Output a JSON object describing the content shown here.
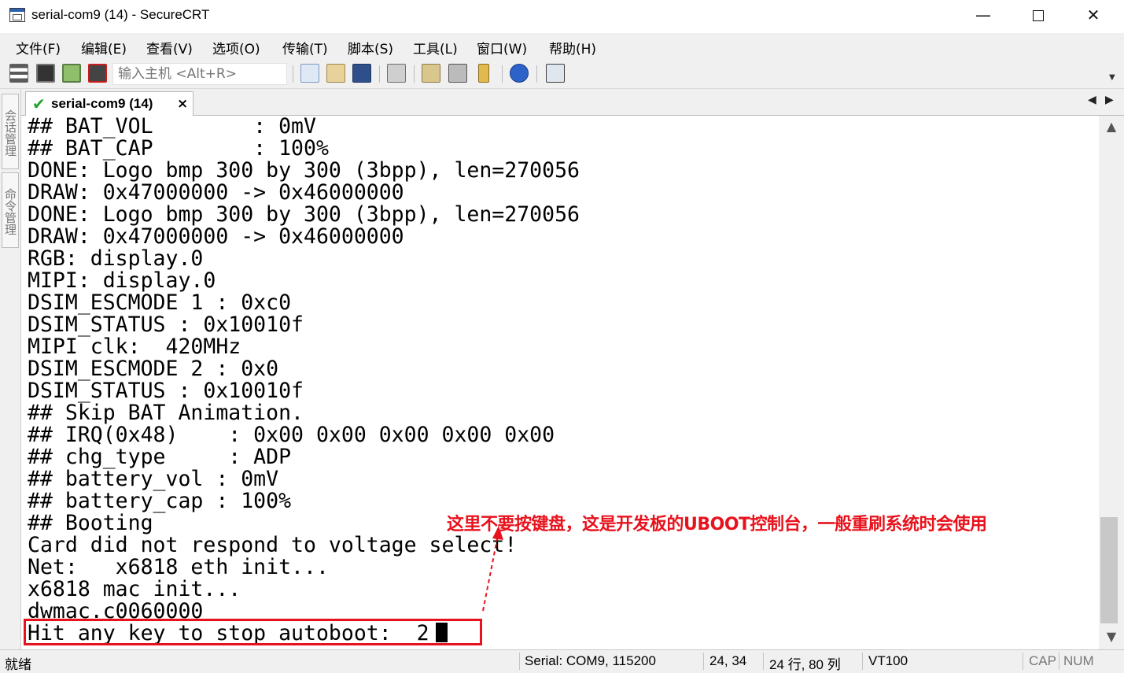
{
  "window": {
    "title": "serial-com9 (14) - SecureCRT",
    "minimize_label": "—",
    "close_label": "✕"
  },
  "menu": {
    "items": [
      "文件(F)",
      "编辑(E)",
      "查看(V)",
      "选项(O)",
      "传输(T)",
      "脚本(S)",
      "工具(L)",
      "窗口(W)",
      "帮助(H)"
    ]
  },
  "toolbar": {
    "host_placeholder": "输入主机 <Alt+R>",
    "icons": [
      "connect-icon",
      "quick-connect-icon",
      "reconnect-icon",
      "disconnect-icon",
      "copy-icon",
      "paste-icon",
      "find-icon",
      "print-icon",
      "session-options-icon",
      "global-options-icon",
      "keymap-icon",
      "help-icon",
      "sftp-icon"
    ]
  },
  "sidebar": {
    "tabs": [
      "会话管理",
      "命令管理"
    ]
  },
  "session_tab": {
    "label": "serial-com9 (14)",
    "close_label": "×",
    "prev_label": "◀",
    "next_label": "▶"
  },
  "terminal": {
    "lines": [
      "## BAT_VOL        : 0mV",
      "## BAT_CAP        : 100%",
      "DONE: Logo bmp 300 by 300 (3bpp), len=270056",
      "DRAW: 0x47000000 -> 0x46000000",
      "DONE: Logo bmp 300 by 300 (3bpp), len=270056",
      "DRAW: 0x47000000 -> 0x46000000",
      "RGB: display.0",
      "MIPI: display.0",
      "DSIM_ESCMODE 1 : 0xc0",
      "DSIM_STATUS : 0x10010f",
      "MIPI clk:  420MHz",
      "DSIM_ESCMODE 2 : 0x0",
      "DSIM_STATUS : 0x10010f",
      "## Skip BAT Animation.",
      "## IRQ(0x48)    : 0x00 0x00 0x00 0x00 0x00",
      "## chg_type     : ADP",
      "## battery_vol : 0mV",
      "## battery_cap : 100%",
      "## Booting",
      "Card did not respond to voltage select!",
      "Net:   x6818 eth init...",
      "x6818 mac init...",
      "dwmac.c0060000",
      "Hit any key to stop autoboot:  2"
    ],
    "annotation": "这里不要按键盘，这是开发板的UBOOT控制台，一般重刷系统时会使用",
    "highlight_color": "#e8121c"
  },
  "scrollbar": {
    "up_label": "▲",
    "down_label": "▼"
  },
  "statusbar": {
    "ready": "就绪",
    "connection": "Serial: COM9, 115200",
    "cursor_pos": "24,  34",
    "size": "24 行, 80 列",
    "emulation": "VT100",
    "cap": "CAP",
    "num": "NUM"
  }
}
